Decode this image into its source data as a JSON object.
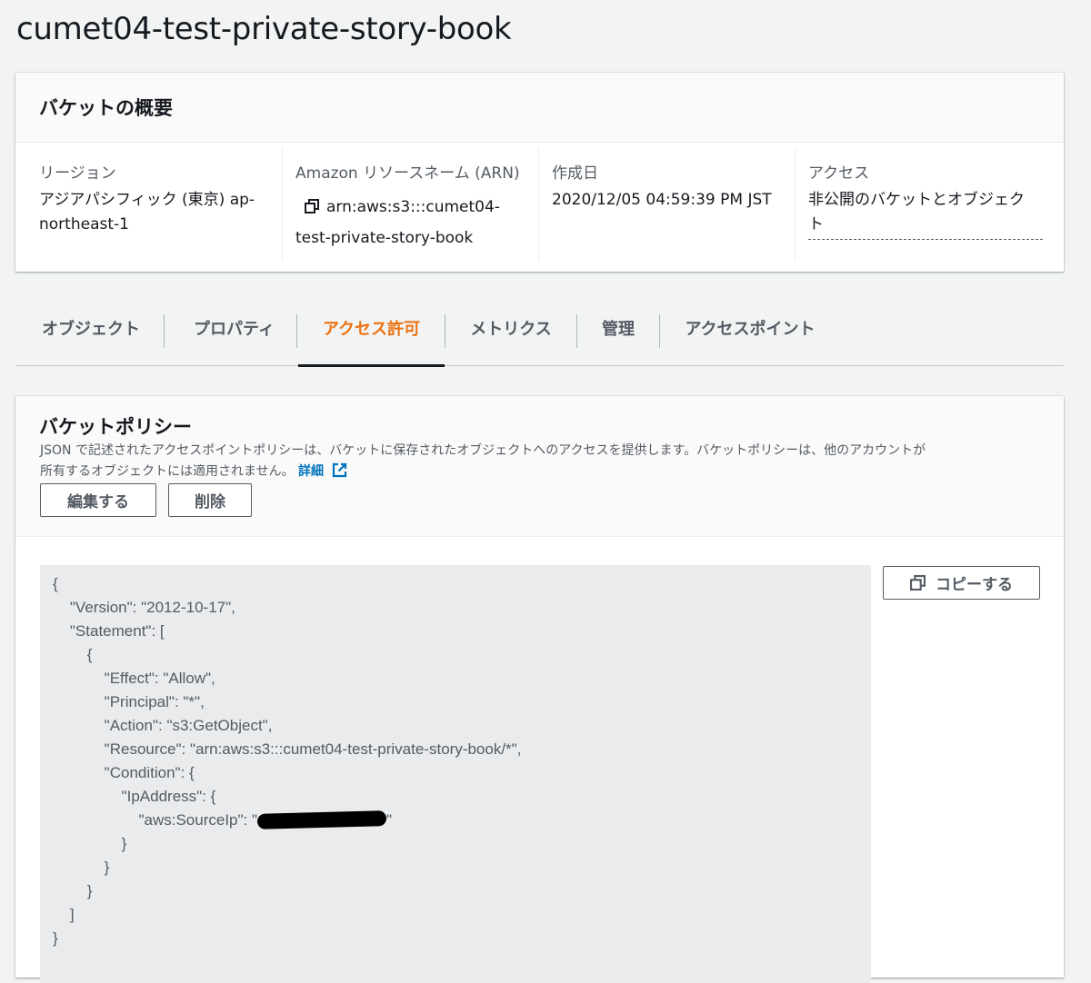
{
  "title": "cumet04-test-private-story-book",
  "overview": {
    "heading": "バケットの概要",
    "region": {
      "label": "リージョン",
      "value_line1": "アジアパシフィック (東京) ap-",
      "value_line2": "northeast-1"
    },
    "arn": {
      "label": "Amazon リソースネーム (ARN)",
      "value_line1": "arn:aws:s3:::cumet04-",
      "value_line2": "test-private-story-book"
    },
    "created": {
      "label": "作成日",
      "value": "2020/12/05 04:59:39 PM JST"
    },
    "access": {
      "label": "アクセス",
      "value_line1": "非公開のバケットとオブジェク",
      "value_line2": "ト"
    }
  },
  "tabs": [
    "オブジェクト",
    "プロパティ",
    "アクセス許可",
    "メトリクス",
    "管理",
    "アクセスポイント"
  ],
  "active_tab": "アクセス許可",
  "policy": {
    "heading": "バケットポリシー",
    "desc_line1": "JSON で記述されたアクセスポイントポリシーは、バケットに保存されたオブジェクトへのアクセスを提供します。バケットポリシーは、他のアカウントが",
    "desc_line2": "所有するオブジェクトには適用されません。",
    "details_link": "詳細",
    "edit_button": "編集する",
    "delete_button": "削除",
    "copy_button": "コピーする",
    "code_lines": [
      "{",
      "    \"Version\": \"2012-10-17\",",
      "    \"Statement\": [",
      "        {",
      "            \"Effect\": \"Allow\",",
      "            \"Principal\": \"*\",",
      "            \"Action\": \"s3:GetObject\",",
      "            \"Resource\": \"arn:aws:s3:::cumet04-test-private-story-book/*\",",
      "            \"Condition\": {",
      "                \"IpAddress\": {",
      "                    \"aws:SourceIp\": \"",
      "                }",
      "            }",
      "        }",
      "    ]",
      "}"
    ],
    "code_line_10_suffix": "\""
  },
  "colors": {
    "accent": "#ec7211",
    "link": "#0073bb",
    "code_bg": "#e9ebed"
  }
}
